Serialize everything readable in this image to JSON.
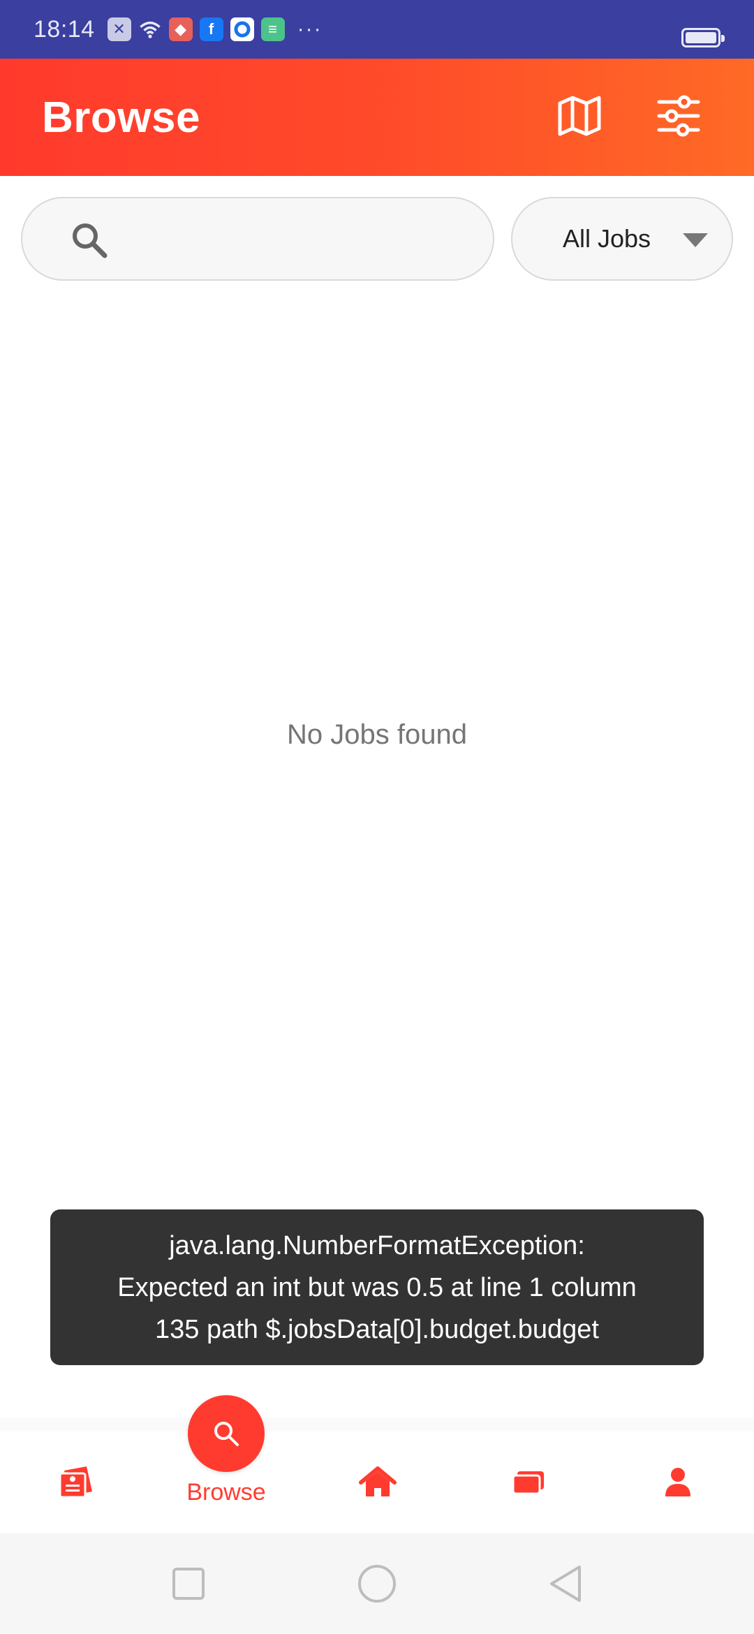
{
  "status_bar": {
    "time": "18:14",
    "more_indicator": "···",
    "notification_icons": [
      "close-badge-icon",
      "wifi-icon",
      "app-icon",
      "facebook-icon",
      "app-icon",
      "app-icon"
    ]
  },
  "app_bar": {
    "title": "Browse",
    "actions": [
      "map-icon",
      "sliders-icon"
    ],
    "gradient": [
      "#ff3a2c",
      "#ff6a26"
    ]
  },
  "search": {
    "placeholder": "",
    "value": ""
  },
  "jobs_filter": {
    "selected": "All Jobs"
  },
  "empty_state": {
    "message": "No Jobs found"
  },
  "toast": {
    "lines": [
      "java.lang.NumberFormatException:",
      "Expected an int but was 0.5 at line 1 column",
      "135 path $.jobsData[0].budget.budget"
    ]
  },
  "bottom_nav": {
    "active_label": "Browse",
    "items": [
      "my-jobs-icon",
      "search-icon",
      "home-icon",
      "messages-icon",
      "profile-icon"
    ],
    "accent": "#ff3b2f"
  },
  "system_nav": {
    "buttons": [
      "recents-icon",
      "home-circle-icon",
      "back-triangle-icon"
    ]
  }
}
